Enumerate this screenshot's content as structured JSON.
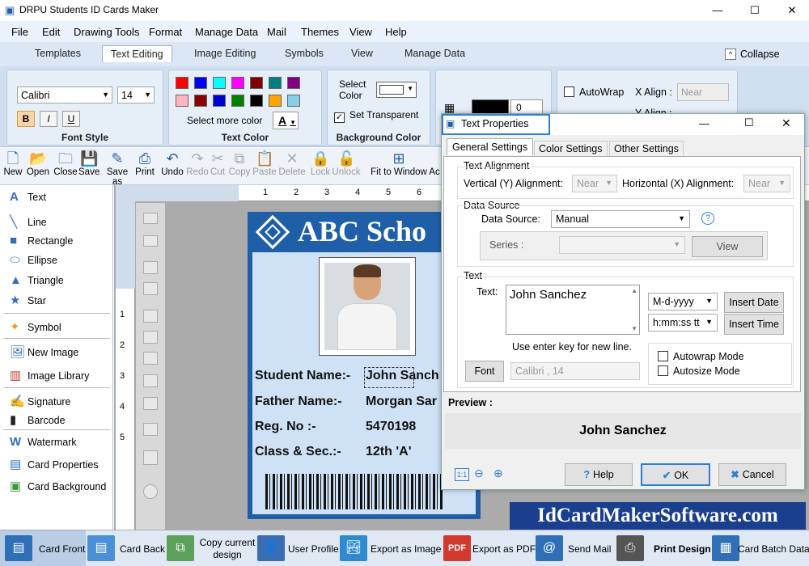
{
  "window": {
    "title": "DRPU Students ID Cards Maker",
    "min": "—",
    "max": "☐",
    "close": "✕"
  },
  "menu": [
    "File",
    "Edit",
    "Drawing Tools",
    "Format",
    "Manage Data",
    "Mail",
    "Themes",
    "View",
    "Help"
  ],
  "ribbon_tabs": {
    "items": [
      "Templates",
      "Text Editing",
      "Image Editing",
      "Symbols",
      "View",
      "Manage Data"
    ],
    "active": "Text Editing",
    "collapse": "Collapse"
  },
  "font_style": {
    "label": "Font Style",
    "font": "Calibri",
    "size": "14",
    "bold": "B",
    "italic": "I",
    "underline": "U"
  },
  "text_color": {
    "label": "Text Color",
    "more": "Select more color",
    "a_label": "A",
    "swatches": [
      "#ff0000",
      "#0000ff",
      "#00ffff",
      "#ff00ff",
      "#800000",
      "#008080",
      "#800080",
      "#ffb6c1",
      "#8b0000",
      "#0000cc",
      "#008000",
      "#000000",
      "#ffa500",
      "#87ceeb"
    ]
  },
  "background_color": {
    "label": "Background Color",
    "select": "Select Color",
    "transparent": "Set Transparent"
  },
  "extra": {
    "width_value": "0",
    "autowrap": "AutoWrap",
    "x_align": "X Align :",
    "y_align": "Y Align :",
    "near": "Near"
  },
  "toolbar": [
    "New",
    "Open",
    "Close",
    "Save",
    "Save as",
    "Print",
    "Undo",
    "Redo",
    "Cut",
    "Copy",
    "Paste",
    "Delete",
    "Lock",
    "Unlock",
    "Fit to Window",
    "Ac"
  ],
  "left_panel": [
    "Text",
    "Line",
    "Rectangle",
    "Ellipse",
    "Triangle",
    "Star",
    "Symbol",
    "New Image",
    "Image Library",
    "Signature",
    "Barcode",
    "Watermark",
    "Card Properties",
    "Card Background"
  ],
  "ruler": {
    "top": [
      "1",
      "2",
      "3",
      "4",
      "5",
      "6"
    ],
    "left": [
      "1",
      "2",
      "3",
      "4",
      "5"
    ]
  },
  "card": {
    "school": "ABC Scho",
    "fields": [
      {
        "label": "Student Name:-",
        "value": "John Sanch"
      },
      {
        "label": "Father Name:-",
        "value": "Morgan Sar"
      },
      {
        "label": "Reg. No :-",
        "value": "5470198"
      },
      {
        "label": "Class & Sec.:-",
        "value": "12th 'A'"
      }
    ]
  },
  "dialog": {
    "title": "Text Properties",
    "tabs": [
      "General Settings",
      "Color Settings",
      "Other Settings"
    ],
    "text_alignment": "Text Alignment",
    "vertical": "Vertical (Y) Alignment:",
    "horizontal": "Horizontal (X) Alignment:",
    "near": "Near",
    "data_source_group": "Data Source",
    "data_source_label": "Data Source:",
    "data_source_value": "Manual",
    "series": "Series :",
    "view": "View",
    "text_group": "Text",
    "text_label": "Text:",
    "text_value": "John Sanchez",
    "hint": "Use enter key for new line.",
    "date_format": "M-d-yyyy",
    "time_format": "h:mm:ss tt",
    "insert_date": "Insert Date",
    "insert_time": "Insert Time",
    "font_btn": "Font",
    "font_value": "Calibri , 14",
    "autowrap": "Autowrap Mode",
    "autosize": "Autosize Mode",
    "preview_label": "Preview :",
    "preview_text": "John Sanchez",
    "zoom": "1:1",
    "help": "Help",
    "ok": "OK",
    "cancel": "Cancel"
  },
  "watermark": "IdCardMakerSoftware.com",
  "bottom": [
    "Card Front",
    "Card Back",
    "Copy current design",
    "User Profile",
    "Export as Image",
    "Export as PDF",
    "Send Mail",
    "Print Design",
    "Card Batch Data"
  ]
}
